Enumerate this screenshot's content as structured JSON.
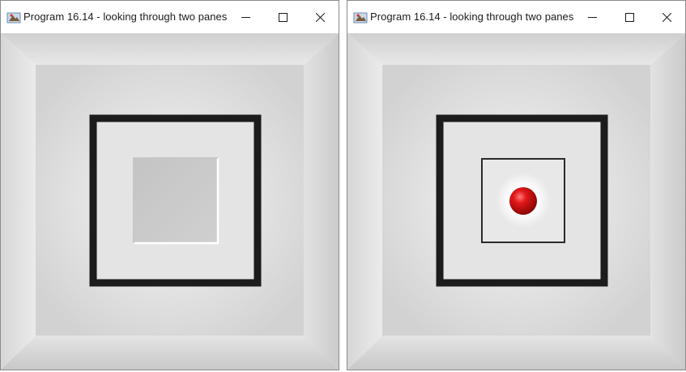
{
  "windows": [
    {
      "title": "Program 16.14 - looking through two panes",
      "controls": {
        "minimize": "minimize-icon",
        "maximize": "maximize-icon",
        "close": "close-icon"
      },
      "icon": "java-app-icon",
      "scene": {
        "inner_pane": "opaque"
      }
    },
    {
      "title": "Program 16.14 - looking through two panes",
      "controls": {
        "minimize": "minimize-icon",
        "maximize": "maximize-icon",
        "close": "close-icon"
      },
      "icon": "java-app-icon",
      "scene": {
        "inner_pane": "transparent",
        "sphere_color": "#dd1111"
      }
    }
  ]
}
